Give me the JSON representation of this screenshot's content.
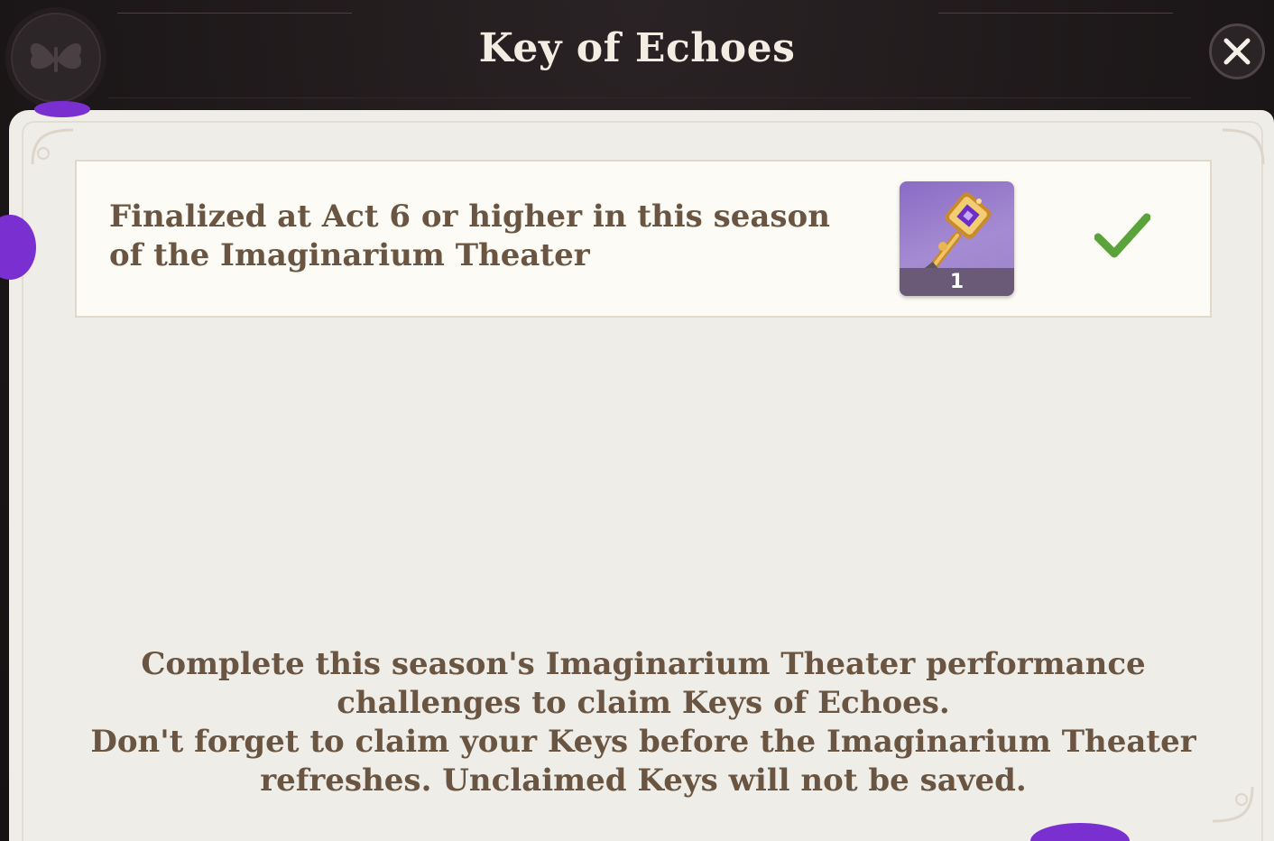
{
  "header": {
    "title": "Key of Echoes"
  },
  "task": {
    "description": "Finalized at Act 6 or higher in this season of the Imaginarium Theater",
    "reward": {
      "icon": "key-of-echoes-icon",
      "count": "1"
    },
    "status": "completed"
  },
  "info": {
    "line1": "Complete this season's Imaginarium Theater performance challenges to claim Keys of Echoes.",
    "line2": "Don't forget to claim your Keys before the Imaginarium Theater refreshes. Unclaimed Keys will not be saved."
  },
  "colors": {
    "header_bg": "#1c1718",
    "panel_bg": "#efede7",
    "text_brown": "#6a5542",
    "check_green": "#5aa33a",
    "reward_purple": "#8a6bc4"
  }
}
